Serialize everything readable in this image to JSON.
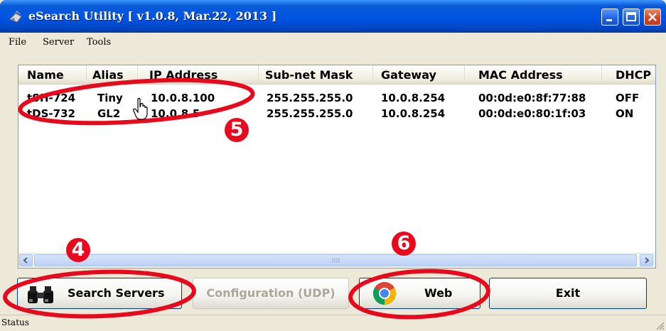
{
  "window": {
    "title": "eSearch Utility [ v1.0.8, Mar.22, 2013 ]"
  },
  "menu": [
    "File",
    "Server",
    "Tools"
  ],
  "table": {
    "columns": [
      "Name",
      "Alias",
      "IP Address",
      "Sub-net Mask",
      "Gateway",
      "MAC Address",
      "DHCP"
    ],
    "rows": [
      [
        "tSH-724",
        "Tiny",
        "10.0.8.100",
        "255.255.255.0",
        "10.0.8.254",
        "00:0d:e0:8f:77:88",
        "OFF"
      ],
      [
        "tDS-732",
        "GL2",
        "10.0.8.5",
        "255.255.255.0",
        "10.0.8.254",
        "00:0d:e0:80:1f:03",
        "ON"
      ]
    ]
  },
  "buttons": {
    "search": "Search Servers",
    "config": "Configuration (UDP)",
    "web": "Web",
    "exit": "Exit"
  },
  "status": "Status",
  "annotations": {
    "n4": "4",
    "n5": "5",
    "n6": "6",
    "color": "#e8091d"
  },
  "icons": [
    "app-icon",
    "minimize-icon",
    "maximize-icon",
    "close-icon",
    "binoculars-icon",
    "chrome-icon",
    "hand-cursor-icon",
    "scroll-left-icon",
    "scroll-right-icon",
    "size-grip-icon"
  ]
}
